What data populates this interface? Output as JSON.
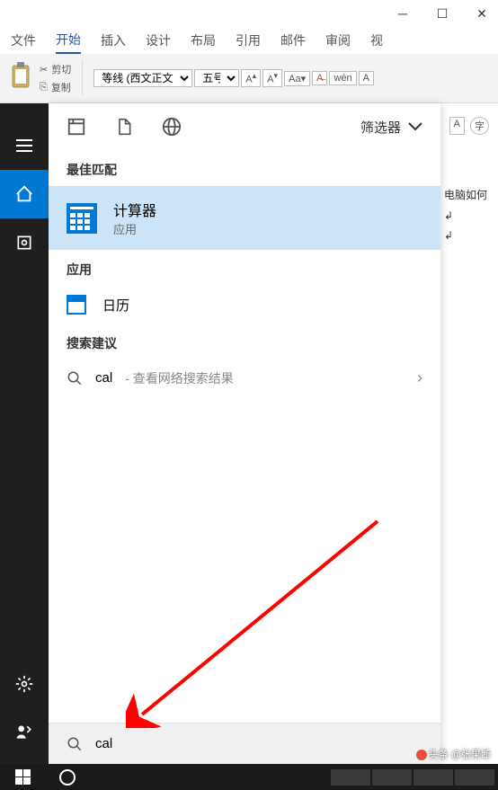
{
  "word": {
    "tabs": [
      "文件",
      "开始",
      "插入",
      "设计",
      "布局",
      "引用",
      "邮件",
      "审阅",
      "视"
    ],
    "active_tab_index": 1,
    "clipboard": {
      "cut": "剪切",
      "copy": "复制"
    },
    "font_name": "等线 (西文正文)",
    "font_size": "五号",
    "text_effect": "wén",
    "doc_text": "电脑如何"
  },
  "search": {
    "filter_label": "筛选器",
    "sections": {
      "best_match": "最佳匹配",
      "apps": "应用",
      "suggestions": "搜索建议"
    },
    "best_match_item": {
      "title": "计算器",
      "subtitle": "应用"
    },
    "app_item": "日历",
    "suggestion": {
      "query": "cal",
      "hint": "- 查看网络搜索结果"
    },
    "input_value": "cal"
  },
  "watermark": {
    "prefix": "头条",
    "author": "@张果断"
  }
}
